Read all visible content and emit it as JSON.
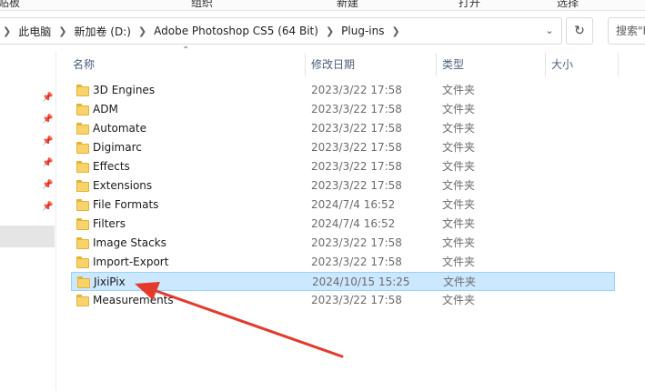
{
  "ribbon": {
    "items": [
      "贴板",
      "组织",
      "新建",
      "打开",
      "选择"
    ]
  },
  "address": {
    "crumbs": [
      "此电脑",
      "新加卷 (D:)",
      "Adobe Photoshop CS5 (64 Bit)",
      "Plug-ins"
    ],
    "dropdown_icon": "chevron-down-icon",
    "refresh_icon": "refresh-icon"
  },
  "search": {
    "placeholder": "搜索\"Plug-ins\""
  },
  "columns": {
    "name": "名称",
    "modified": "修改日期",
    "type": "类型",
    "size": "大小"
  },
  "files": [
    {
      "name": "3D Engines",
      "modified": "2023/3/22 17:58",
      "type": "文件夹",
      "selected": false
    },
    {
      "name": "ADM",
      "modified": "2023/3/22 17:58",
      "type": "文件夹",
      "selected": false
    },
    {
      "name": "Automate",
      "modified": "2023/3/22 17:58",
      "type": "文件夹",
      "selected": false
    },
    {
      "name": "Digimarc",
      "modified": "2023/3/22 17:58",
      "type": "文件夹",
      "selected": false
    },
    {
      "name": "Effects",
      "modified": "2023/3/22 17:58",
      "type": "文件夹",
      "selected": false
    },
    {
      "name": "Extensions",
      "modified": "2023/3/22 17:58",
      "type": "文件夹",
      "selected": false
    },
    {
      "name": "File Formats",
      "modified": "2024/7/4 16:52",
      "type": "文件夹",
      "selected": false
    },
    {
      "name": "Filters",
      "modified": "2024/7/4 16:52",
      "type": "文件夹",
      "selected": false
    },
    {
      "name": "Image Stacks",
      "modified": "2023/3/22 17:58",
      "type": "文件夹",
      "selected": false
    },
    {
      "name": "Import-Export",
      "modified": "2023/3/22 17:58",
      "type": "文件夹",
      "selected": false
    },
    {
      "name": "JixiPix",
      "modified": "2024/10/15 15:25",
      "type": "文件夹",
      "selected": true
    },
    {
      "name": "Measurements",
      "modified": "2023/3/22 17:58",
      "type": "文件夹",
      "selected": false
    }
  ],
  "colors": {
    "selection_bg": "#cce8ff",
    "selection_border": "#99d1ff",
    "folder": "#f8d26a",
    "header_text": "#4c607a",
    "annotation_arrow": "#e53a2b"
  }
}
